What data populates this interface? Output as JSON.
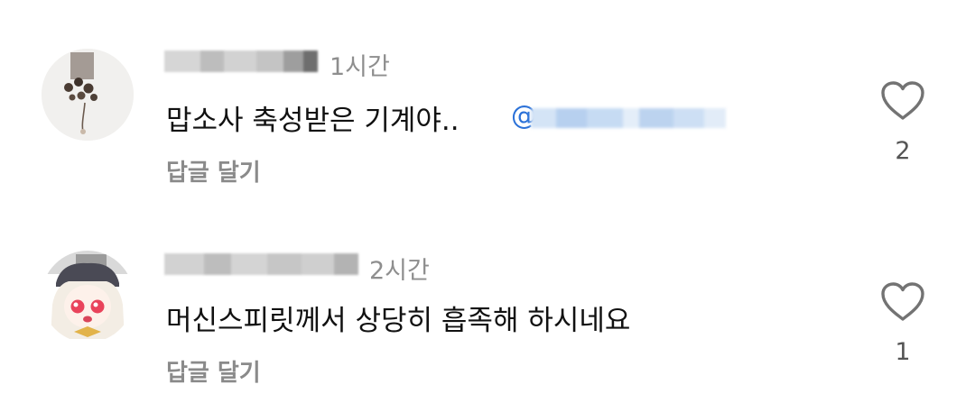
{
  "comments": [
    {
      "username": "",
      "time": "1시간",
      "text": "맙소사 축성받은 기계야..",
      "mention_symbol": "@",
      "mention": "",
      "reply_label": "답글 달기",
      "likes": "2",
      "icons": {
        "like": "heart-outline-icon"
      }
    },
    {
      "username": "",
      "time": "2시간",
      "text": "머신스피릿께서 상당히 흡족해 하시네요",
      "reply_label": "답글 달기",
      "likes": "1",
      "icons": {
        "like": "heart-outline-icon"
      }
    }
  ],
  "colors": {
    "mention": "#2b71d8",
    "secondary_text": "#8e8e8e",
    "primary_text": "#111111"
  }
}
